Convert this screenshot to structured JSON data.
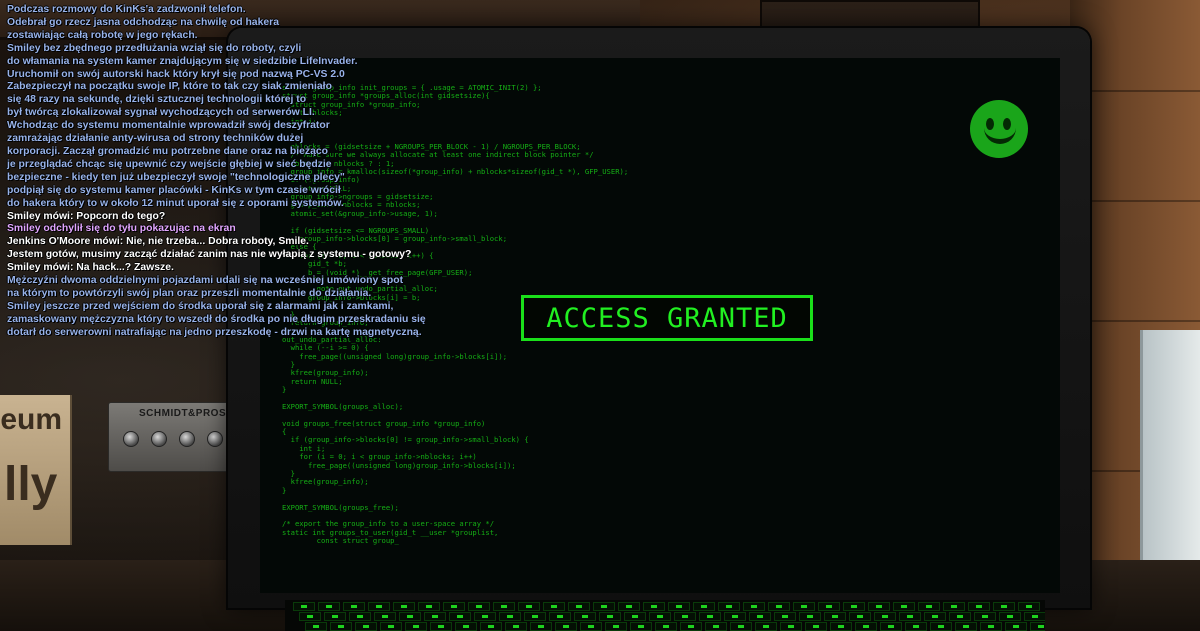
{
  "screen": {
    "status_banner": "ACCESS GRANTED",
    "status_color": "#21f021",
    "code_color": "#17c117",
    "smiley_icon": "smiley-face-icon",
    "code_lines": [
      "struct group_info init_groups = { .usage = ATOMIC_INIT(2) };",
      "struct group_info *groups_alloc(int gidsetsize){",
      "  struct group_info *group_info;",
      "  int nblocks;",
      "  int i;",
      "",
      "",
      "  nblocks = (gidsetsize + NGROUPS_PER_BLOCK - 1) / NGROUPS_PER_BLOCK;",
      "  /* Make sure we always allocate at least one indirect block pointer */",
      "  nblocks = nblocks ? : 1;",
      "  group_info = kmalloc(sizeof(*group_info) + nblocks*sizeof(gid_t *), GFP_USER);",
      "  if (!group_info)",
      "    return NULL;",
      "  group_info->ngroups = gidsetsize;",
      "  group_info->nblocks = nblocks;",
      "  atomic_set(&group_info->usage, 1);",
      "",
      "  if (gidsetsize <= NGROUPS_SMALL)",
      "    group_info->blocks[0] = group_info->small_block;",
      "  else {",
      "    for (i = 0; i < nblocks; i++) {",
      "      gid_t *b;",
      "      b = (void *)__get_free_page(GFP_USER);",
      "      if (!b)",
      "        goto out_undo_partial_alloc;",
      "      group_info->blocks[i] = b;",
      "    }",
      "  }",
      "  return group_info;",
      "",
      "out_undo_partial_alloc:",
      "  while (--i >= 0) {",
      "    free_page((unsigned long)group_info->blocks[i]);",
      "  }",
      "  kfree(group_info);",
      "  return NULL;",
      "}",
      "",
      "EXPORT_SYMBOL(groups_alloc);",
      "",
      "void groups_free(struct group_info *group_info)",
      "{",
      "  if (group_info->blocks[0] != group_info->small_block) {",
      "    int i;",
      "    for (i = 0; i < group_info->nblocks; i++)",
      "      free_page((unsigned long)group_info->blocks[i]);",
      "  }",
      "  kfree(group_info);",
      "}",
      "",
      "EXPORT_SYMBOL(groups_free);",
      "",
      "/* export the group_info to a user-space array */",
      "static int groups_to_user(gid_t __user *grouplist,",
      "        const struct group_"
    ]
  },
  "scene": {
    "amp_brand": "SCHMIDT&PROSS",
    "poster_text_1": "leum",
    "poster_text_2": "lly"
  },
  "chat": [
    {
      "type": "narr",
      "text": "Podczas rozmowy do KinKs'a zadzwonił telefon."
    },
    {
      "type": "narr",
      "text": "Odebrał go rzecz jasna odchodząc na chwilę od hakera"
    },
    {
      "type": "narr",
      "text": "zostawiając całą robotę w jego rękach."
    },
    {
      "type": "narr",
      "text": "Smiley bez zbędnego przedłużania wziął się do roboty, czyli"
    },
    {
      "type": "narr",
      "text": "do włamania na system kamer znajdującym się w siedzibie LifeInvader."
    },
    {
      "type": "narr",
      "text": "Uruchomił on swój autorski hack który krył się pod nazwą PC-VS 2.0"
    },
    {
      "type": "narr",
      "text": "Zabezpieczył na początku swoje IP, które to tak czy siak zmieniało"
    },
    {
      "type": "narr",
      "text": "się 48 razy na sekundę, dzięki sztucznej technologii której to"
    },
    {
      "type": "narr",
      "text": "był twórcą zlokalizował sygnał wychodzących od serwerów LI."
    },
    {
      "type": "narr",
      "text": "Wchodząc do systemu momentalnie wprowadził swój deszyfrator"
    },
    {
      "type": "narr",
      "text": "zamrażając działanie anty-wirusa od strony techników dużej"
    },
    {
      "type": "narr",
      "text": "korporacji. Zaczął gromadzić mu potrzebne dane oraz na bieżąco"
    },
    {
      "type": "narr",
      "text": "je przeglądać chcąc się upewnić czy wejście głębiej w sieć będzie"
    },
    {
      "type": "narr",
      "text": "bezpieczne - kiedy ten już ubezpieczył swoje \"technologiczne plecy\""
    },
    {
      "type": "narr",
      "text": "podpiął się do systemu kamer placówki - KinKs w tym czasie wrócił"
    },
    {
      "type": "narr",
      "text": "do hakera który to w około 12 minut uporał się z oporami systemów."
    },
    {
      "type": "say",
      "text": "Smiley mówi: Popcorn do tego?"
    },
    {
      "type": "emote",
      "text": "Smiley odchylił się do tyłu pokazując na ekran"
    },
    {
      "type": "say",
      "text": "Jenkins O'Moore mówi: Nie, nie trzeba... Dobra roboty, Smile."
    },
    {
      "type": "say",
      "text": "Jestem gotów, musimy zacząć działać zanim nas nie wyłapią z systemu - gotowy?"
    },
    {
      "type": "say",
      "text": "Smiley mówi: Na hack...? Zawsze."
    },
    {
      "type": "narr",
      "text": "Mężczyźni dwoma oddzielnymi pojazdami udali się na wcześniej umówiony spot"
    },
    {
      "type": "narr",
      "text": "na którym to powtórzyli swój plan oraz przeszli momentalnie do działania."
    },
    {
      "type": "narr",
      "text": "Smiley jeszcze przed wejściem do środka uporał się z alarmami jak i zamkami,"
    },
    {
      "type": "narr",
      "text": "zamaskowany mężczyzna który to wszedł do środka po nie długim przeskradaniu się"
    },
    {
      "type": "narr",
      "text": "dotarł do serwerowni natrafiając na jedno przeszkodę - drzwi na kartę magnetyczną."
    }
  ]
}
